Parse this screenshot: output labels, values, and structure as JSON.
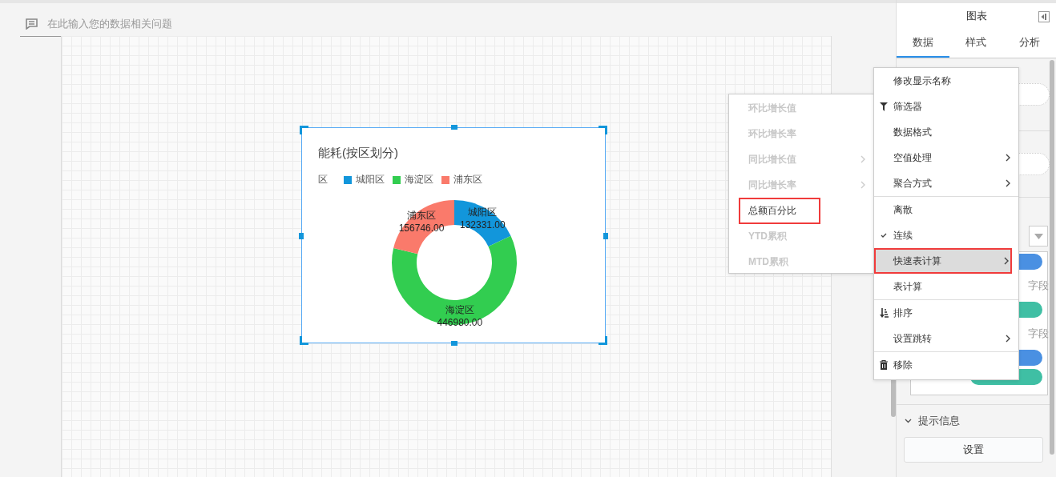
{
  "question_bar": {
    "placeholder": "在此输入您的数据相关问题"
  },
  "chart": {
    "legend_title": "区",
    "legend": [
      {
        "label": "城阳区",
        "color": "#1296db"
      },
      {
        "label": "海淀区",
        "color": "#32cd50"
      },
      {
        "label": "浦东区",
        "color": "#fa7a6b"
      }
    ],
    "selected": true,
    "chart_data": {
      "type": "donut",
      "title": "能耗(按区划分)",
      "categories": [
        "城阳区",
        "海淀区",
        "浦东区"
      ],
      "values": [
        132331,
        446980,
        156746
      ],
      "data_labels": true,
      "value_labels": [
        "132331.00",
        "446980.00",
        "156746.00"
      ]
    }
  },
  "side_panel": {
    "title": "图表",
    "tabs": [
      {
        "label": "数据",
        "selected": true
      },
      {
        "label": "样式",
        "selected": false
      },
      {
        "label": "分析",
        "selected": false
      }
    ],
    "field_notes": [
      "字段",
      "字段"
    ],
    "section": {
      "label": "提示信息",
      "expanded": true,
      "button": "设置"
    }
  },
  "context_menu": [
    {
      "label": "修改显示名称",
      "kind": "plain",
      "checked": false,
      "submenu": false,
      "highlighted": false,
      "group_end": false
    },
    {
      "label": "筛选器",
      "kind": "filter",
      "checked": false,
      "submenu": false,
      "highlighted": false,
      "group_end": false
    },
    {
      "label": "数据格式",
      "kind": "plain",
      "checked": false,
      "submenu": false,
      "highlighted": false,
      "group_end": false
    },
    {
      "label": "空值处理",
      "kind": "plain",
      "checked": false,
      "submenu": true,
      "highlighted": false,
      "group_end": false
    },
    {
      "label": "聚合方式",
      "kind": "plain",
      "checked": false,
      "submenu": true,
      "highlighted": false,
      "group_end": true
    },
    {
      "label": "离散",
      "kind": "plain",
      "checked": false,
      "submenu": false,
      "highlighted": false,
      "group_end": false
    },
    {
      "label": "连续",
      "kind": "plain",
      "checked": true,
      "submenu": false,
      "highlighted": false,
      "group_end": false
    },
    {
      "label": "快速表计算",
      "kind": "plain",
      "checked": false,
      "submenu": true,
      "highlighted": true,
      "group_end": false
    },
    {
      "label": "表计算",
      "kind": "plain",
      "checked": false,
      "submenu": false,
      "highlighted": false,
      "group_end": true
    },
    {
      "label": "排序",
      "kind": "sort",
      "checked": false,
      "submenu": false,
      "highlighted": false,
      "group_end": false
    },
    {
      "label": "设置跳转",
      "kind": "plain",
      "checked": false,
      "submenu": true,
      "highlighted": false,
      "group_end": true
    },
    {
      "label": "移除",
      "kind": "trash",
      "checked": false,
      "submenu": false,
      "highlighted": false,
      "group_end": false
    }
  ],
  "submenu": [
    {
      "label": "环比增长值",
      "disabled": true,
      "submenu": false,
      "highlighted": false
    },
    {
      "label": "环比增长率",
      "disabled": true,
      "submenu": false,
      "highlighted": false
    },
    {
      "label": "同比增长值",
      "disabled": true,
      "submenu": true,
      "highlighted": false
    },
    {
      "label": "同比增长率",
      "disabled": true,
      "submenu": true,
      "highlighted": false
    },
    {
      "label": "总额百分比",
      "disabled": false,
      "submenu": false,
      "highlighted": true
    },
    {
      "label": "YTD累积",
      "disabled": true,
      "submenu": false,
      "highlighted": false
    },
    {
      "label": "MTD累积",
      "disabled": true,
      "submenu": false,
      "highlighted": false
    }
  ]
}
